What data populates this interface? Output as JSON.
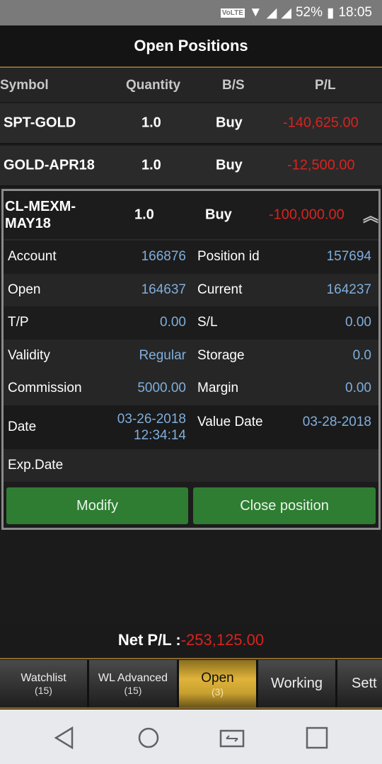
{
  "status_bar": {
    "volte": "VoLTE",
    "battery": "52%",
    "time": "18:05"
  },
  "header": {
    "title": "Open Positions"
  },
  "columns": [
    "Symbol",
    "Quantity",
    "B/S",
    "P/L"
  ],
  "positions": [
    {
      "symbol": "SPT-GOLD",
      "quantity": "1.0",
      "side": "Buy",
      "pl": "-140,625.00"
    },
    {
      "symbol": "GOLD-APR18",
      "quantity": "1.0",
      "side": "Buy",
      "pl": "-12,500.00"
    }
  ],
  "expanded": {
    "symbol_line1": "CL-MEXM-",
    "symbol_line2": "MAY18",
    "quantity": "1.0",
    "side": "Buy",
    "pl": "-100,000.00",
    "details": [
      {
        "l1": "Account",
        "v1": "166876",
        "l2": "Position id",
        "v2": "157694"
      },
      {
        "l1": "Open",
        "v1": "164637",
        "l2": "Current",
        "v2": "164237"
      },
      {
        "l1": "T/P",
        "v1": "0.00",
        "l2": "S/L",
        "v2": "0.00"
      },
      {
        "l1": "Validity",
        "v1": "Regular",
        "l2": "Storage",
        "v2": "0.0"
      },
      {
        "l1": "Commission",
        "v1": "5000.00",
        "l2": "Margin",
        "v2": "0.00"
      }
    ],
    "date_label": "Date",
    "date_value": "03-26-2018",
    "date_time": "12:34:14",
    "value_date_label": "Value Date",
    "value_date": "03-28-2018",
    "exp_date_label": "Exp.Date",
    "modify": "Modify",
    "close": "Close position"
  },
  "net": {
    "label": "Net P/L :",
    "value": "-253,125.00"
  },
  "tabs": [
    {
      "label": "Watchlist",
      "count": "(15)"
    },
    {
      "label": "WL Advanced",
      "count": "(15)"
    },
    {
      "label": "Open",
      "count": "(3)",
      "active": true
    },
    {
      "label": "Working"
    },
    {
      "label": "Sett"
    }
  ],
  "colors": {
    "negative": "#d8231f",
    "value": "#80aedc",
    "button": "#2e7d32",
    "active_tab": "#e0b43a"
  }
}
